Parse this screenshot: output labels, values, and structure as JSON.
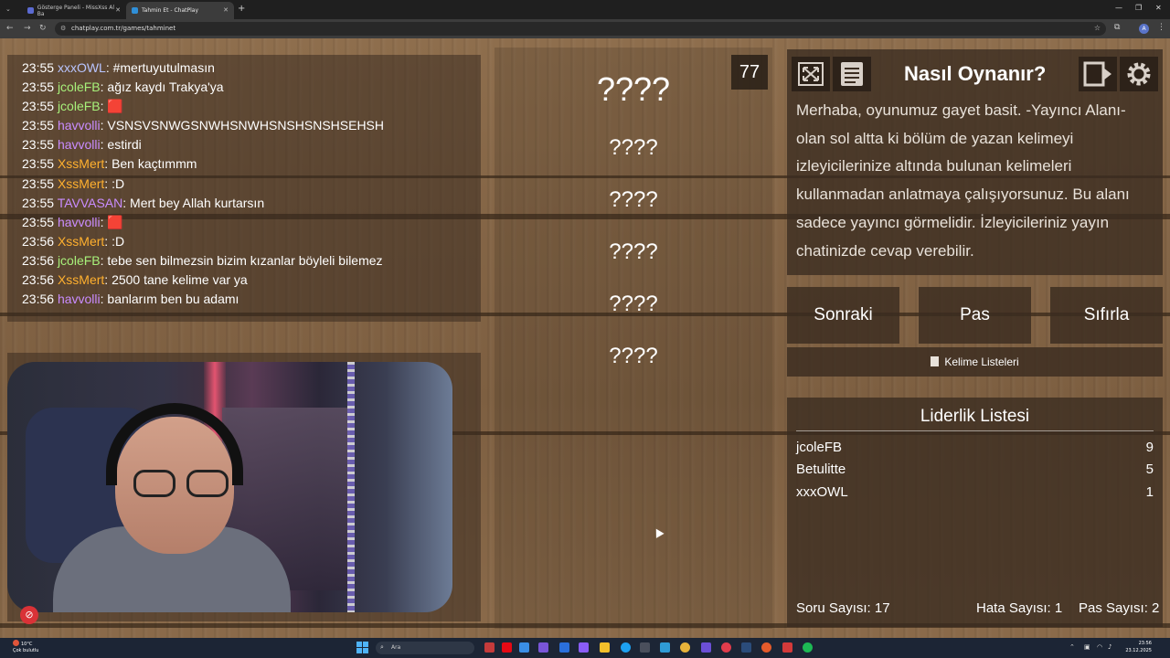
{
  "browser": {
    "tabs": [
      {
        "title": "Gösterge Paneli - MissXss Al Ba"
      },
      {
        "title": "Tahmin Et - ChatPlay"
      }
    ],
    "url": "chatplay.com.tr/games/tahminet",
    "profile_initial": "A"
  },
  "chat": {
    "messages": [
      {
        "time": "23:55",
        "user": "xxxOWL",
        "color": "#b9c5ff",
        "text": "#mertuyutulmasın"
      },
      {
        "time": "23:55",
        "user": "jcoleFB",
        "color": "#a7f07a",
        "text": "ağız kaydı Trakya'ya"
      },
      {
        "time": "23:55",
        "user": "jcoleFB",
        "color": "#a7f07a",
        "text": "🟥"
      },
      {
        "time": "23:55",
        "user": "havvolli",
        "color": "#c98cff",
        "text": "VSNSVSNWGSNWHSNWHSNSHSNSHSEHSH"
      },
      {
        "time": "23:55",
        "user": "havvolli",
        "color": "#c98cff",
        "text": "estirdi"
      },
      {
        "time": "23:55",
        "user": "XssMert",
        "color": "#ffb02e",
        "text": "Ben kaçtımmm"
      },
      {
        "time": "23:55",
        "user": "XssMert",
        "color": "#ffb02e",
        "text": ":D"
      },
      {
        "time": "23:55",
        "user": "TAVVASAN",
        "color": "#c98cff",
        "text": "Mert bey Allah kurtarsın"
      },
      {
        "time": "23:55",
        "user": "havvolli",
        "color": "#c98cff",
        "text": "🟥"
      },
      {
        "time": "23:56",
        "user": "XssMert",
        "color": "#ffb02e",
        "text": ":D"
      },
      {
        "time": "23:56",
        "user": "jcoleFB",
        "color": "#a7f07a",
        "text": "tebe sen bilmezsin bizim kızanlar böyleli bilemez"
      },
      {
        "time": "23:56",
        "user": "XssMert",
        "color": "#ffb02e",
        "text": "2500 tane kelime var ya"
      },
      {
        "time": "23:56",
        "user": "havvolli",
        "color": "#c98cff",
        "text": "banlarım ben bu adamı"
      }
    ]
  },
  "game": {
    "counter": "77",
    "main_word": "????",
    "hint_words": [
      "????",
      "????",
      "????",
      "????",
      "????"
    ]
  },
  "info": {
    "title": "Nasıl Oynanır?",
    "text": "Merhaba, oyunumuz gayet basit. -Yayıncı Alanı- olan sol altta ki bölüm de yazan kelimeyi izleyicilerinize altında bulunan kelimeleri kullanmadan anlatmaya çalışıyorsunuz. Bu alanı sadece yayıncı görmelidir. İzleyicileriniz yayın chatinizde cevap verebilir."
  },
  "actions": {
    "next": "Sonraki",
    "pass": "Pas",
    "reset": "Sıfırla",
    "word_lists": "Kelime Listeleri"
  },
  "leaderboard": {
    "title": "Liderlik Listesi",
    "rows": [
      {
        "name": "jcoleFB",
        "score": "9"
      },
      {
        "name": "Betulitte",
        "score": "5"
      },
      {
        "name": "xxxOWL",
        "score": "1"
      }
    ],
    "question_count": "Soru Sayısı: 17",
    "error_count": "Hata Sayısı: 1",
    "pass_count": "Pas Sayısı: 2"
  },
  "taskbar": {
    "weather_temp": "10°C",
    "weather_desc": "Çok bulutlu",
    "search_placeholder": "Ara",
    "time": "23:56",
    "date": "23.12.2025"
  }
}
